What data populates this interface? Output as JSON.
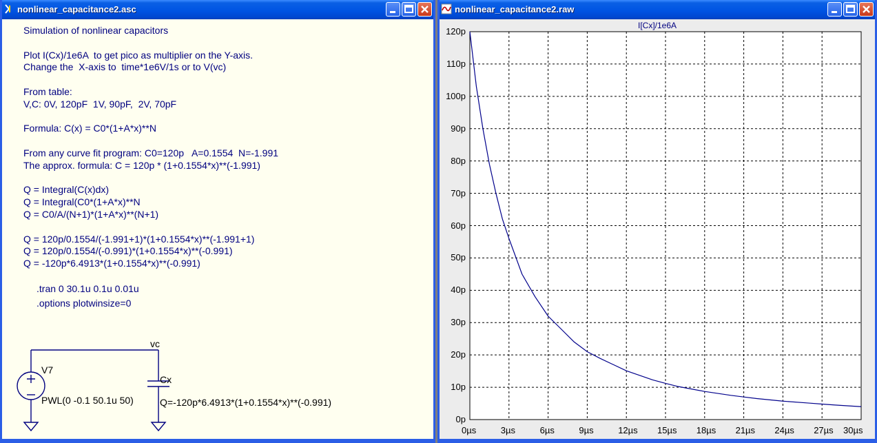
{
  "windows": {
    "schematic": {
      "title": "nonlinear_capacitance2.asc",
      "notes": [
        "Simulation of nonlinear capacitors",
        "",
        "Plot I(Cx)/1e6A  to get pico as multiplier on the Y-axis.",
        "Change the  X-axis to  time*1e6V/1s or to V(vc)",
        "",
        "From table:",
        "V,C: 0V, 120pF  1V, 90pF,  2V, 70pF",
        "",
        "Formula: C(x) = C0*(1+A*x)**N",
        "",
        "From any curve fit program: C0=120p   A=0.1554  N=-1.991",
        "The approx. formula: C = 120p * (1+0.1554*x)**(-1.991)",
        "",
        "Q = Integral(C(x)dx)",
        "Q = Integral(C0*(1+A*x)**N",
        "Q = C0/A/(N+1)*(1+A*x)**(N+1)",
        "",
        "Q = 120p/0.1554/(-1.991+1)*(1+0.1554*x)**(-1.991+1)",
        "Q = 120p/0.1554/(-0.991)*(1+0.1554*x)**(-0.991)",
        "Q = -120p*6.4913*(1+0.1554*x)**(-0.991)"
      ],
      "directives": {
        "tran": ".tran 0 30.1u 0.1u 0.01u",
        "options": ".options plotwinsize=0"
      },
      "circuit": {
        "net_label": "vc",
        "source_name": "V7",
        "source_value": "PWL(0 -0.1 50.1u 50)",
        "cap_name": "Cx",
        "cap_value": "Q=-120p*6.4913*(1+0.1554*x)**(-0.991)"
      }
    },
    "waveform": {
      "title": "nonlinear_capacitance2.raw",
      "trace_name": "I[Cx]/1e6A"
    }
  },
  "chart_data": {
    "type": "line",
    "title": "I[Cx]/1e6A",
    "xlabel": "",
    "ylabel": "",
    "x_ticks": [
      "0µs",
      "3µs",
      "6µs",
      "9µs",
      "12µs",
      "15µs",
      "18µs",
      "21µs",
      "24µs",
      "27µs",
      "30µs"
    ],
    "y_ticks": [
      "0p",
      "10p",
      "20p",
      "30p",
      "40p",
      "50p",
      "60p",
      "70p",
      "80p",
      "90p",
      "100p",
      "110p",
      "120p"
    ],
    "xlim": [
      0,
      30
    ],
    "ylim": [
      0,
      120
    ],
    "grid": true,
    "series": [
      {
        "name": "I[Cx]/1e6A",
        "color": "#00008b",
        "x": [
          0,
          0.5,
          1,
          1.5,
          2,
          2.5,
          3,
          4,
          5,
          6,
          7,
          8,
          9,
          10,
          12,
          14,
          15,
          16,
          18,
          20,
          21,
          22,
          24,
          26,
          27,
          28,
          30
        ],
        "y": [
          120,
          103,
          90,
          79,
          70,
          62,
          56,
          45,
          38,
          32,
          28,
          24,
          21,
          18.9,
          15.1,
          12.3,
          11.2,
          10.2,
          8.7,
          7.5,
          7.0,
          6.5,
          5.7,
          5.1,
          4.8,
          4.5,
          4.0
        ]
      }
    ]
  }
}
